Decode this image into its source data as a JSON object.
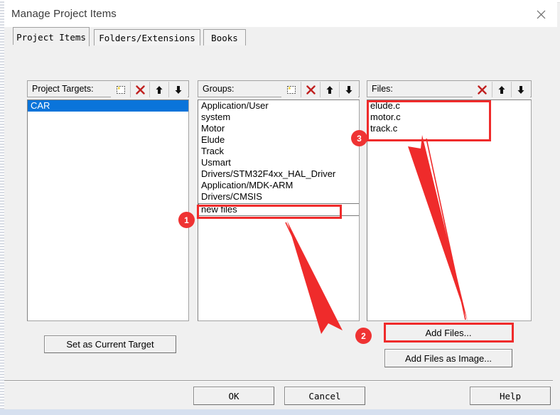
{
  "window": {
    "title": "Manage Project Items",
    "close_icon": "close-icon"
  },
  "tabs": [
    {
      "label": "Project Items",
      "active": true
    },
    {
      "label": "Folders/Extensions",
      "active": false
    },
    {
      "label": "Books",
      "active": false
    }
  ],
  "panels": {
    "targets": {
      "header": "Project Targets:",
      "icons": [
        "new-item-icon",
        "delete-icon",
        "move-up-icon",
        "move-down-icon"
      ],
      "items": [
        "CAR"
      ],
      "selected": "CAR"
    },
    "groups": {
      "header": "Groups:",
      "icons": [
        "new-item-icon",
        "delete-icon",
        "move-up-icon",
        "move-down-icon"
      ],
      "items": [
        "Application/User",
        "system",
        "Motor",
        "Elude",
        "Track",
        "Usmart",
        "Drivers/STM32F4xx_HAL_Driver",
        "Application/MDK-ARM",
        "Drivers/CMSIS"
      ],
      "edit_value": "new files"
    },
    "files": {
      "header": "Files:",
      "icons": [
        "delete-icon",
        "move-up-icon",
        "move-down-icon"
      ],
      "items": [
        "elude.c",
        "motor.c",
        "track.c"
      ]
    }
  },
  "buttons": {
    "set_as_current_target": "Set as Current Target",
    "add_files": "Add Files...",
    "add_files_as_image": "Add Files as Image...",
    "ok": "OK",
    "cancel": "Cancel",
    "help": "Help"
  },
  "annotations": {
    "accent_color": "#ef2b2b",
    "badges": [
      {
        "number": "1",
        "target": "groups-edit-field"
      },
      {
        "number": "2",
        "target": "add-files-button"
      },
      {
        "number": "3",
        "target": "files-list"
      }
    ],
    "arrows": [
      {
        "from": "groups-edit-field",
        "to": "add-files-button"
      },
      {
        "from": "add-files-button",
        "to": "files-list"
      }
    ]
  }
}
